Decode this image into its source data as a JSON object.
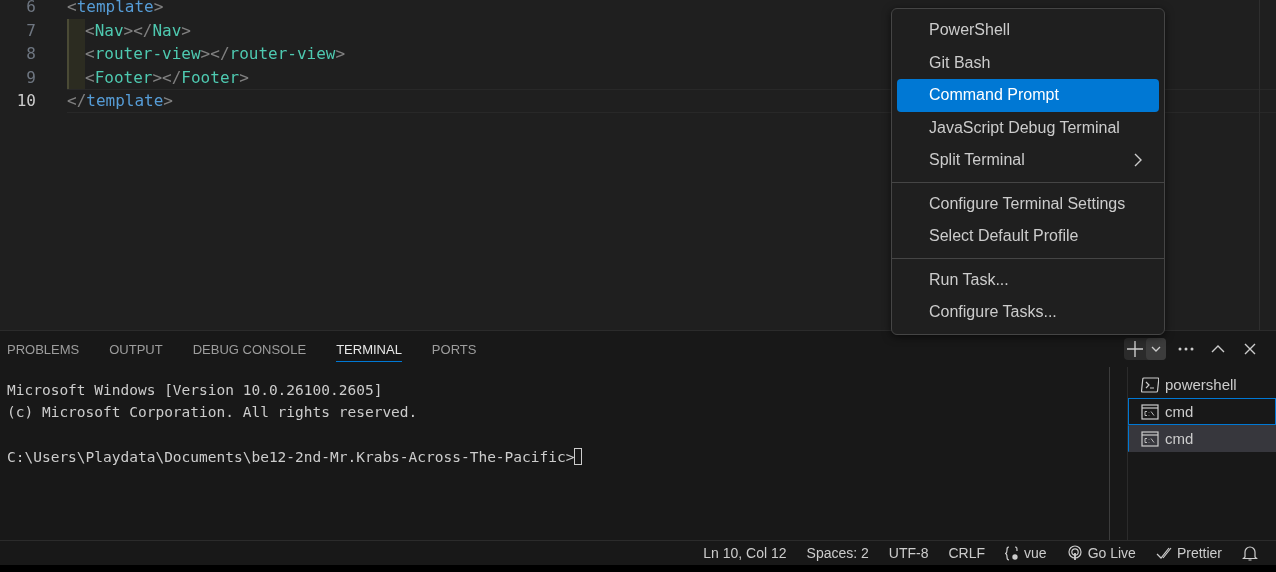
{
  "editor": {
    "lines": [
      {
        "number": "6",
        "current": false,
        "guide": false,
        "tokens": [
          {
            "text": "<",
            "kind": "bracket"
          },
          {
            "text": "template",
            "kind": "tag"
          },
          {
            "text": ">",
            "kind": "bracket"
          }
        ]
      },
      {
        "number": "7",
        "current": false,
        "guide": true,
        "tokens": [
          {
            "text": "<",
            "kind": "bracket"
          },
          {
            "text": "Nav",
            "kind": "component"
          },
          {
            "text": "></",
            "kind": "bracket"
          },
          {
            "text": "Nav",
            "kind": "component"
          },
          {
            "text": ">",
            "kind": "bracket"
          }
        ]
      },
      {
        "number": "8",
        "current": false,
        "guide": true,
        "tokens": [
          {
            "text": "<",
            "kind": "bracket"
          },
          {
            "text": "router-view",
            "kind": "component"
          },
          {
            "text": "></",
            "kind": "bracket"
          },
          {
            "text": "router-view",
            "kind": "component"
          },
          {
            "text": ">",
            "kind": "bracket"
          }
        ]
      },
      {
        "number": "9",
        "current": false,
        "guide": true,
        "tokens": [
          {
            "text": "<",
            "kind": "bracket"
          },
          {
            "text": "Footer",
            "kind": "component"
          },
          {
            "text": "></",
            "kind": "bracket"
          },
          {
            "text": "Footer",
            "kind": "component"
          },
          {
            "text": ">",
            "kind": "bracket"
          }
        ]
      },
      {
        "number": "10",
        "current": true,
        "guide": false,
        "tokens": [
          {
            "text": "</",
            "kind": "bracket"
          },
          {
            "text": "template",
            "kind": "tag"
          },
          {
            "text": ">",
            "kind": "bracket"
          }
        ]
      }
    ]
  },
  "menu": {
    "items": [
      {
        "kind": "item",
        "label": "PowerShell",
        "selected": false
      },
      {
        "kind": "item",
        "label": "Git Bash",
        "selected": false
      },
      {
        "kind": "item",
        "label": "Command Prompt",
        "selected": true
      },
      {
        "kind": "item",
        "label": "JavaScript Debug Terminal",
        "selected": false
      },
      {
        "kind": "submenu",
        "label": "Split Terminal",
        "selected": false
      },
      {
        "kind": "separator"
      },
      {
        "kind": "item",
        "label": "Configure Terminal Settings",
        "selected": false
      },
      {
        "kind": "item",
        "label": "Select Default Profile",
        "selected": false
      },
      {
        "kind": "separator"
      },
      {
        "kind": "item",
        "label": "Run Task...",
        "selected": false
      },
      {
        "kind": "item",
        "label": "Configure Tasks...",
        "selected": false
      }
    ]
  },
  "panel": {
    "tabs": [
      {
        "label": "PROBLEMS",
        "selected": false
      },
      {
        "label": "OUTPUT",
        "selected": false
      },
      {
        "label": "DEBUG CONSOLE",
        "selected": false
      },
      {
        "label": "TERMINAL",
        "selected": true
      },
      {
        "label": "PORTS",
        "selected": false
      }
    ],
    "terminal_blocks": [
      [
        "Microsoft Windows [Version 10.0.26100.2605]",
        "(c) Microsoft Corporation. All rights reserved."
      ],
      [
        "C:\\Users\\Playdata\\Documents\\be12-2nd-Mr.Krabs-Across-The-Pacific>"
      ]
    ],
    "terminals": [
      {
        "kind": "powershell",
        "label": "powershell",
        "focused": false,
        "selected": false
      },
      {
        "kind": "cmd",
        "label": "cmd",
        "focused": true,
        "selected": false
      },
      {
        "kind": "cmd",
        "label": "cmd",
        "focused": false,
        "selected": true
      }
    ]
  },
  "status_bar": [
    {
      "kind": "text",
      "text": "Ln 10, Col 12"
    },
    {
      "kind": "text",
      "text": "Spaces: 2"
    },
    {
      "kind": "text",
      "text": "UTF-8"
    },
    {
      "kind": "text",
      "text": "CRLF"
    },
    {
      "kind": "language",
      "text": "vue"
    },
    {
      "kind": "live-server",
      "text": "Go Live"
    },
    {
      "kind": "formatter",
      "text": "Prettier"
    },
    {
      "kind": "notifications"
    }
  ]
}
